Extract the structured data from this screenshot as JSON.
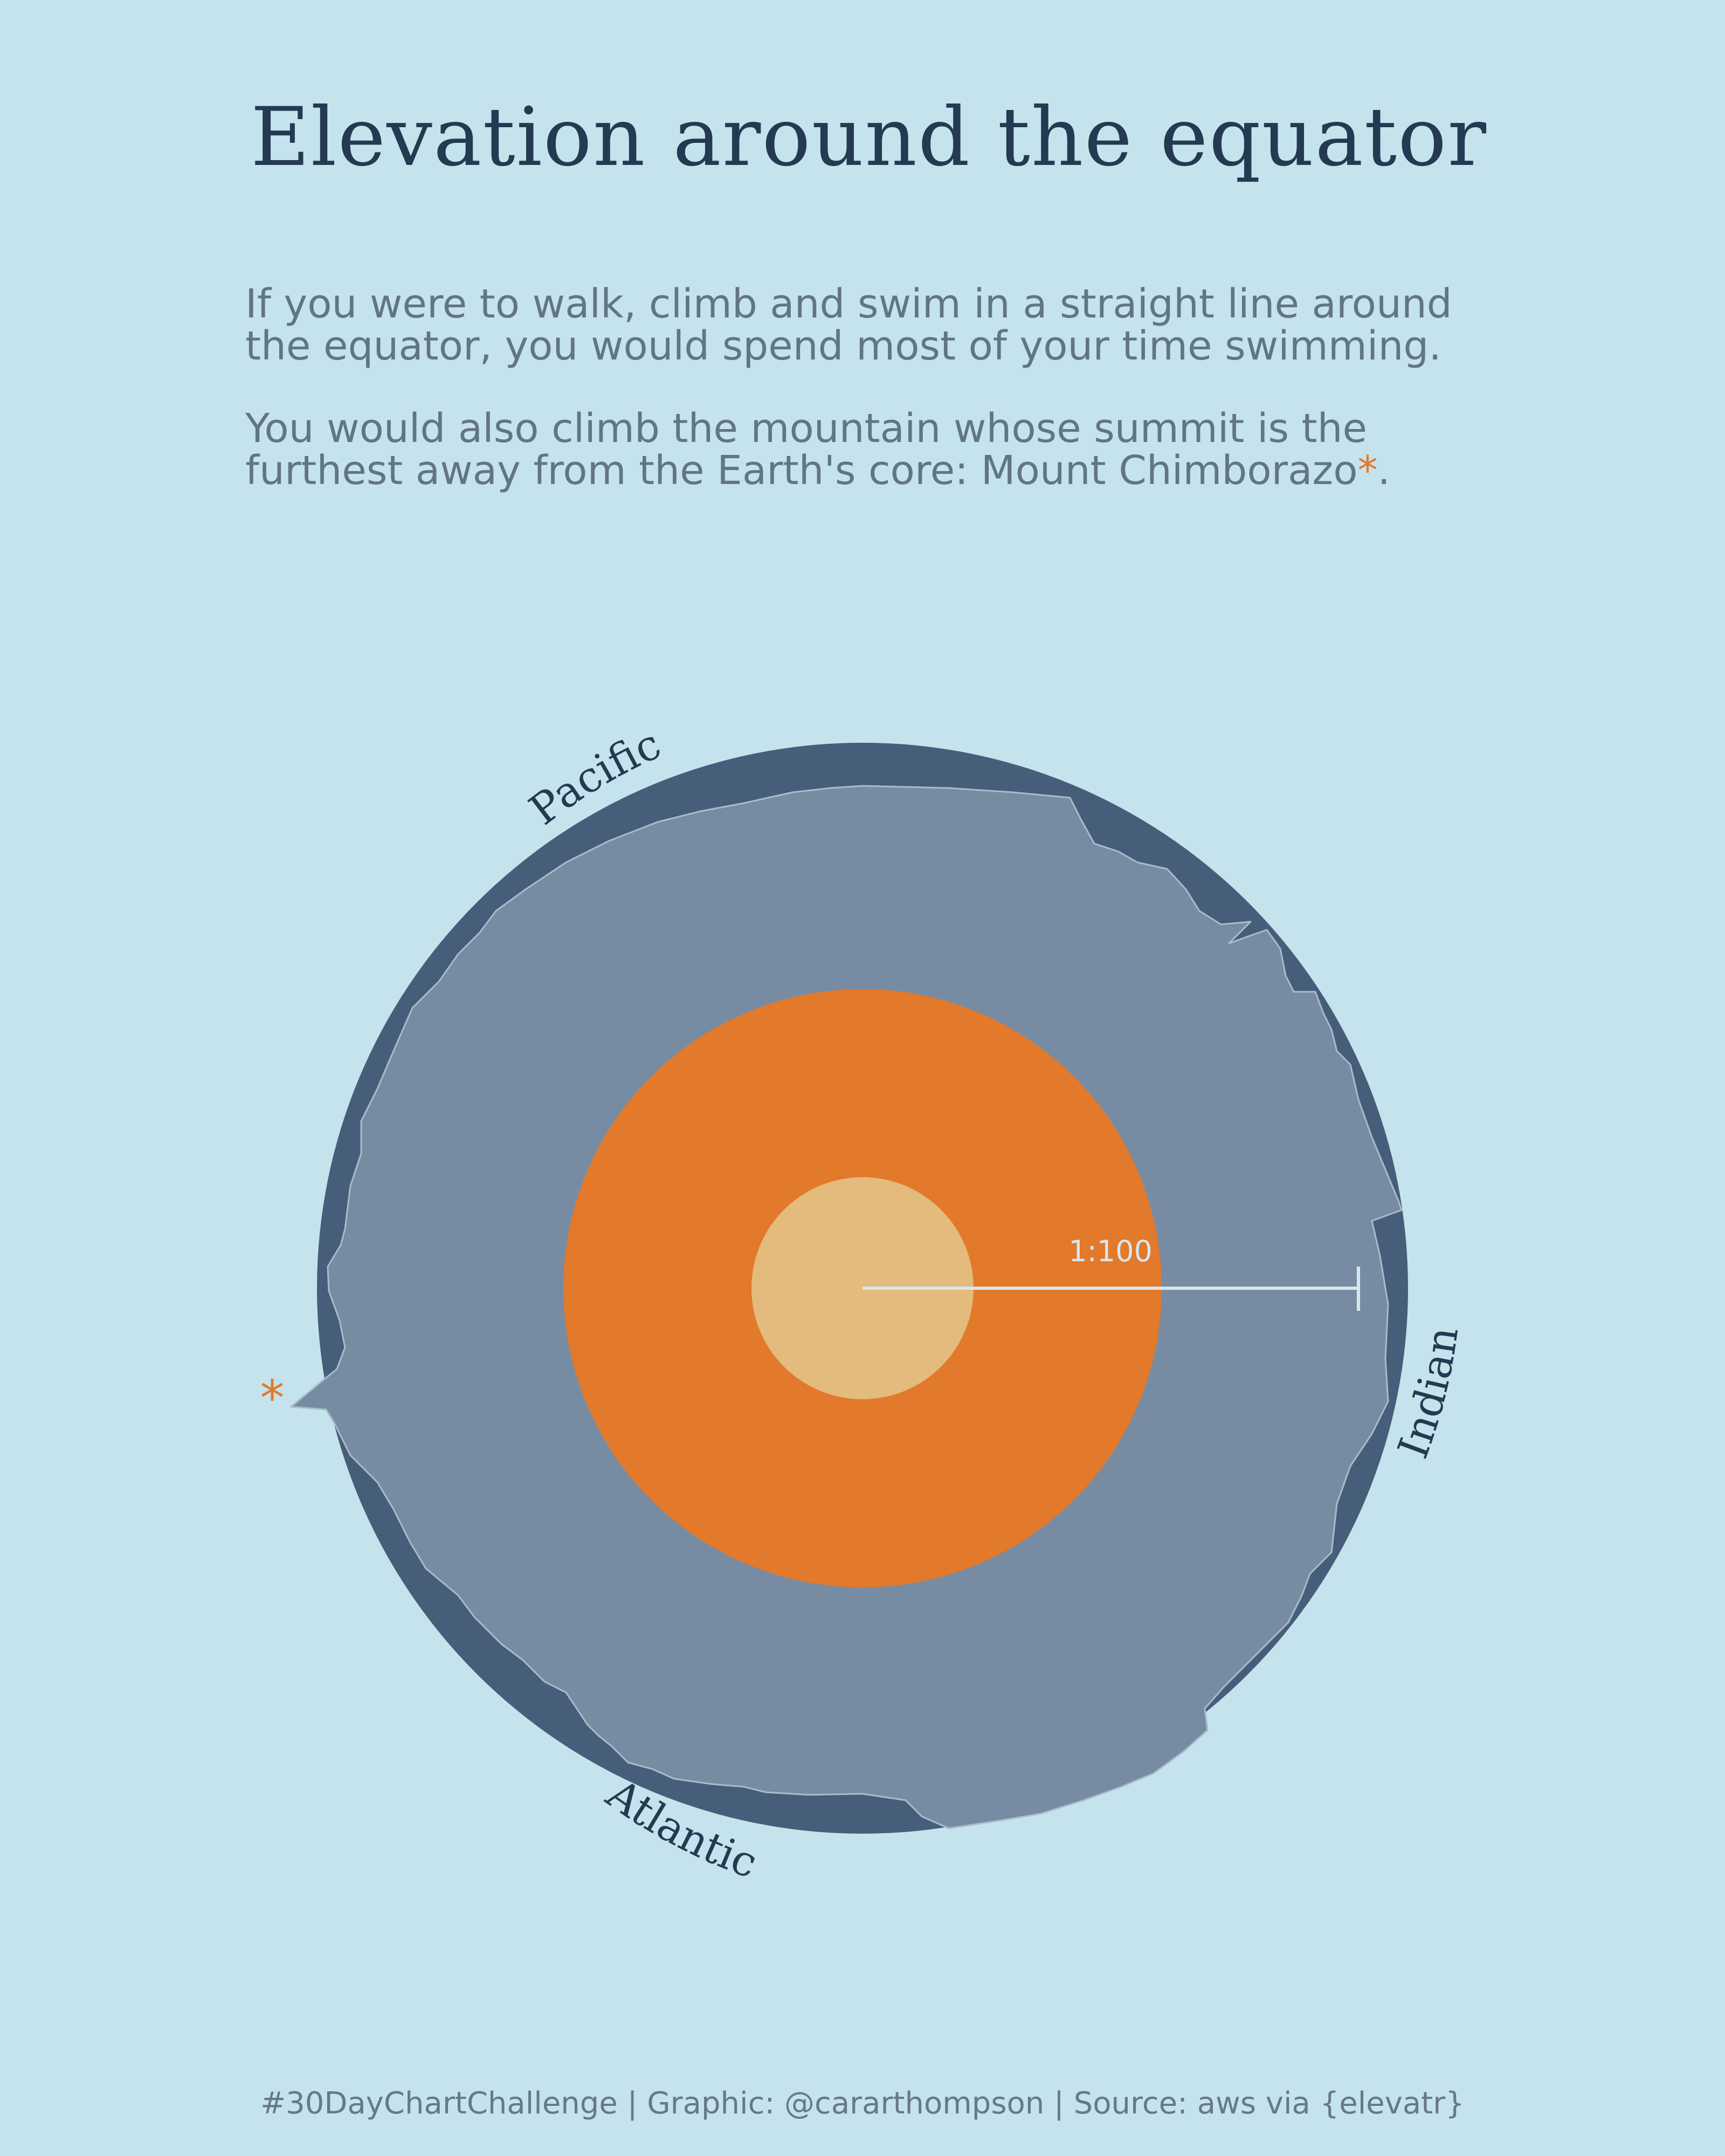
{
  "title": "Elevation around the equator",
  "subtitle": {
    "paragraph_1": "If you were to walk, climb and swim in a straight line around the equator, you would spend most of your time swimming.",
    "paragraph_2": "You would also climb the mountain whose summit is the furthest away from the Earth's core: Mount Chimborazo",
    "marker": "*",
    "ending": "."
  },
  "caption": "#30DayChartChallenge | Graphic: @cararthompson | Source: aws via {elevatr}",
  "colors": {
    "background": "#c5e3ec",
    "ocean": "#465e7a",
    "land": "#778ca3",
    "outer_core": "#e2792b",
    "inner_core": "#e2bb7d",
    "scale_line": "#d8e6ee",
    "marker": "#e17a2e",
    "label": "#243a52"
  },
  "chart_data": {
    "type": "radial-area",
    "title": "Elevation around the equator",
    "layers": [
      "ocean",
      "land",
      "outer core",
      "inner core"
    ],
    "scale_label": "1:100",
    "ocean_labels": [
      "Pacific",
      "Indian",
      "Atlantic"
    ],
    "highlight": {
      "name": "Mount Chimborazo",
      "marker": "*"
    }
  }
}
